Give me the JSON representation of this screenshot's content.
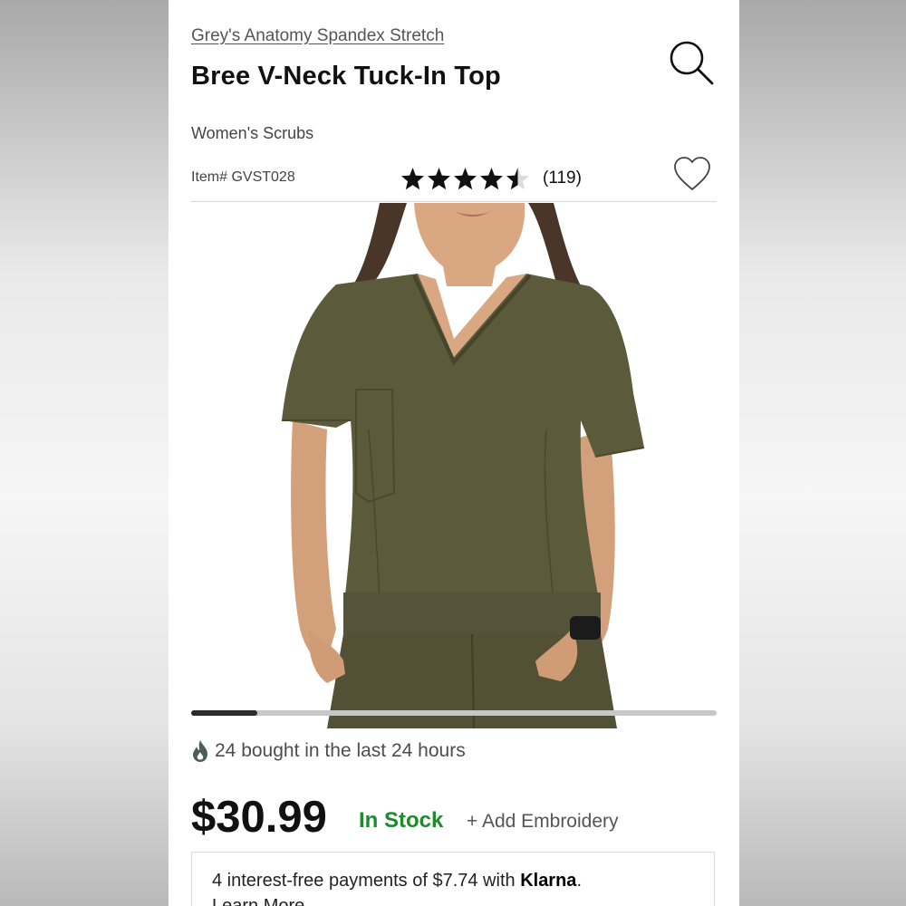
{
  "product": {
    "brand_link": "Grey's Anatomy Spandex Stretch",
    "title": "Bree V-Neck Tuck-In Top",
    "category": "Women's Scrubs",
    "item_number": "Item# GVST028",
    "rating": {
      "stars": 4.5,
      "max": 5,
      "review_count": "(119)"
    },
    "image": {
      "subject": "olive green v-neck scrub top",
      "carousel_progress": 0.125
    },
    "popularity": "24 bought in the last 24 hours",
    "price": "$30.99",
    "stock_status": "In Stock",
    "embroidery_link": "+ Add Embroidery",
    "klarna": {
      "prefix": "4 interest-free payments of $7.74 with ",
      "brand": "Klarna",
      "suffix": ".",
      "learn_more": "Learn More"
    }
  },
  "icons": {
    "search": "search-icon",
    "favorite": "heart-icon",
    "popularity": "flame-icon",
    "rating": "star-icon"
  },
  "colors": {
    "accent_stock": "#1f8a2c",
    "text_primary": "#111111",
    "scrub_olive": "#5b5a3a"
  }
}
